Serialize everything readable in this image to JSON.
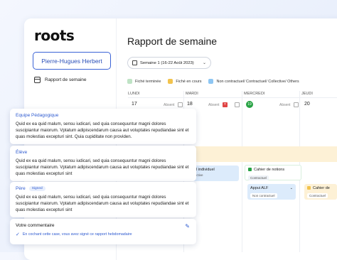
{
  "app": {
    "logo": "roots",
    "user_name": "Pierre-Hugues Herbert",
    "nav_report": "Rapport de semaine"
  },
  "page": {
    "title": "Rapport de semaine",
    "week_label": "Semaine 1 (16-22 Août 2023)"
  },
  "legend": [
    {
      "label": "Fiché terminée",
      "color": "#bfe3c5"
    },
    {
      "label": "Fiché en cours",
      "color": "#f2c34d"
    },
    {
      "label": "Non contractuel/ Contractuel/ Collective/ Others",
      "color": "#8ec6f3"
    }
  ],
  "calendar": {
    "days": [
      "LUNDI",
      "MARDI",
      "MERCREDI",
      "JEUDI"
    ],
    "dates": [
      "17",
      "18",
      "19",
      "20"
    ],
    "absent": "Absent",
    "events": {
      "individuel": "avail individuel",
      "individuel_tag": "Collective",
      "notions": "Cahier de notions",
      "notions_tag": "Contractuel",
      "appui": "Appui ALF",
      "appui_tag": "Non contractuel",
      "cahier": "Cahier de",
      "cahier_tag": "Contractuel"
    }
  },
  "cards": {
    "team_title": "Equipe Pédagogique",
    "team_body": "Quid ex ea quid malum, sensu iudicari, sed quia consequuntur magni dolores suscipiantur maiorum. Vptatum adipiscendarum causa aut voluptates repudiandae sint et quas molestias excepturi sint. Quia cupiditate non providen.",
    "student_title": "Élève",
    "student_body": "Quid ex ea quid malum, sensu iudicari, sed quia consequuntur magni dolores suscipiantur maiorum. Vptatum adipiscendarum causa aut voluptates repudiandae sint et quas molestias excepturi sint",
    "father_title": "Père",
    "father_badge": "Signed",
    "father_body": "Quid ex ea quid malum, sensu iudicari, sed quia consequuntur magni dolores suscipiantur maiorum. Vptatum adipiscendarum causa aut voluptates repudiandae sint et quas molestias excepturi sint",
    "comment_title": "Votre commentaire",
    "comment_note": "En cochant cette case, vous avez signé ce rapport hebdomadaire"
  }
}
